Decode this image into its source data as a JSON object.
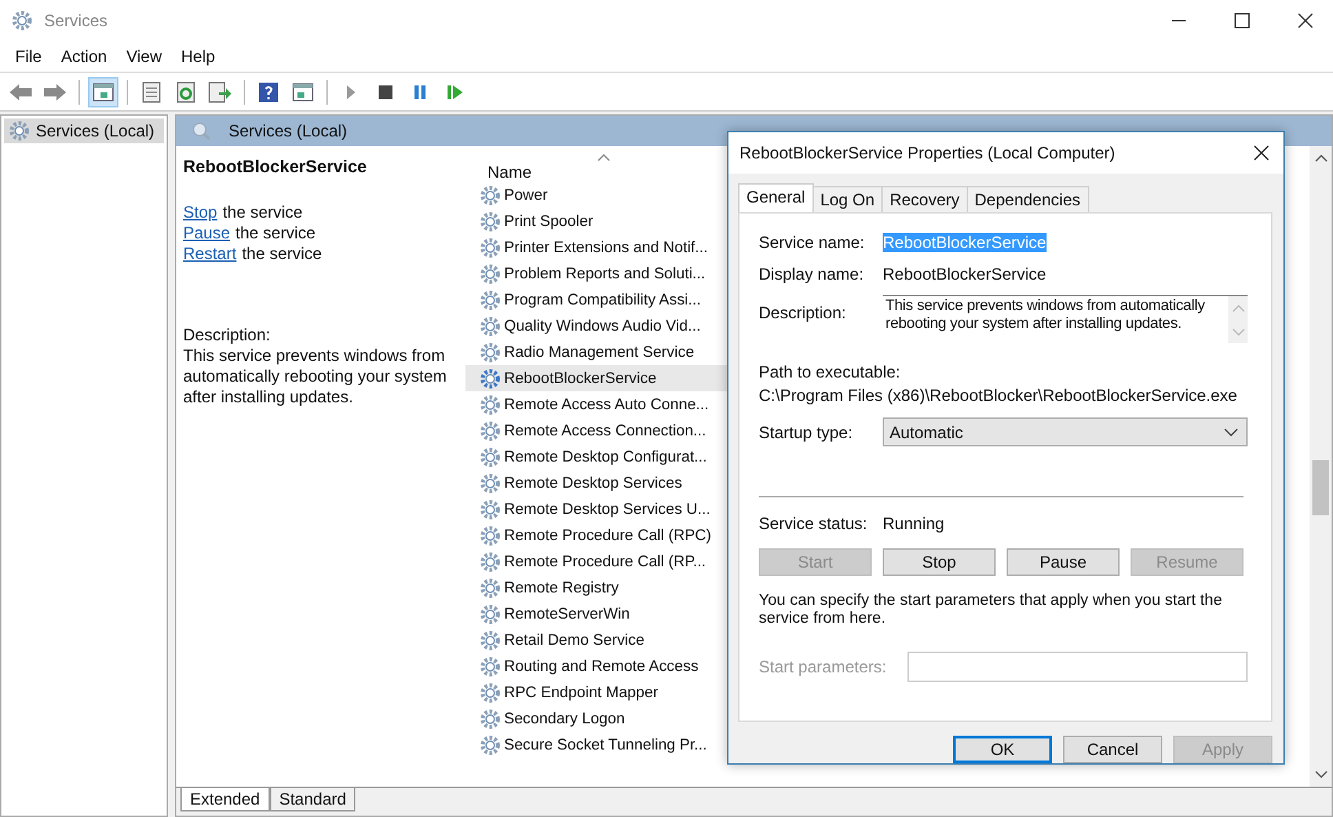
{
  "window": {
    "title": "Services"
  },
  "menu": [
    "File",
    "Action",
    "View",
    "Help"
  ],
  "toolbar": [
    [
      {
        "kind": "back",
        "selected": false
      },
      {
        "kind": "forward",
        "selected": false
      }
    ],
    [
      {
        "kind": "console",
        "selected": true
      }
    ],
    [
      {
        "kind": "properties",
        "selected": false
      },
      {
        "kind": "refresh",
        "selected": false
      },
      {
        "kind": "export",
        "selected": false
      }
    ],
    [
      {
        "kind": "help",
        "selected": false
      },
      {
        "kind": "view",
        "selected": false
      }
    ],
    [
      {
        "kind": "play",
        "selected": false
      },
      {
        "kind": "stop",
        "selected": false
      },
      {
        "kind": "pause",
        "selected": false
      },
      {
        "kind": "resume",
        "selected": false
      }
    ]
  ],
  "tree": {
    "items": [
      {
        "label": "Services (Local)",
        "selected": true
      }
    ]
  },
  "pane": {
    "title": "Services (Local)"
  },
  "details": {
    "service": "RebootBlockerService",
    "actions": [
      {
        "link": "Stop",
        "text": "the service"
      },
      {
        "link": "Pause",
        "text": "the service"
      },
      {
        "link": "Restart",
        "text": "the service"
      }
    ],
    "description_label": "Description:",
    "description": "This service prevents windows from automatically rebooting your system after installing updates."
  },
  "list": {
    "column": "Name",
    "rows": [
      {
        "name": "Power",
        "selected": false
      },
      {
        "name": "Print Spooler",
        "selected": false
      },
      {
        "name": "Printer Extensions and Notif...",
        "selected": false
      },
      {
        "name": "Problem Reports and Soluti...",
        "selected": false
      },
      {
        "name": "Program Compatibility Assi...",
        "selected": false
      },
      {
        "name": "Quality Windows Audio Vid...",
        "selected": false
      },
      {
        "name": "Radio Management Service",
        "selected": false
      },
      {
        "name": "RebootBlockerService",
        "selected": true
      },
      {
        "name": "Remote Access Auto Conne...",
        "selected": false
      },
      {
        "name": "Remote Access Connection...",
        "selected": false
      },
      {
        "name": "Remote Desktop Configurat...",
        "selected": false
      },
      {
        "name": "Remote Desktop Services",
        "selected": false
      },
      {
        "name": "Remote Desktop Services U...",
        "selected": false
      },
      {
        "name": "Remote Procedure Call (RPC)",
        "selected": false
      },
      {
        "name": "Remote Procedure Call (RP...",
        "selected": false
      },
      {
        "name": "Remote Registry",
        "selected": false
      },
      {
        "name": "RemoteServerWin",
        "selected": false
      },
      {
        "name": "Retail Demo Service",
        "selected": false
      },
      {
        "name": "Routing and Remote Access",
        "selected": false
      },
      {
        "name": "RPC Endpoint Mapper",
        "selected": false
      },
      {
        "name": "Secondary Logon",
        "selected": false
      },
      {
        "name": "Secure Socket Tunneling Pr...",
        "selected": false
      }
    ]
  },
  "view_tabs": [
    {
      "label": "Extended",
      "selected": true
    },
    {
      "label": "Standard",
      "selected": false
    }
  ],
  "dialog": {
    "title": "RebootBlockerService Properties (Local Computer)",
    "tabs": [
      {
        "label": "General",
        "selected": true
      },
      {
        "label": "Log On",
        "selected": false
      },
      {
        "label": "Recovery",
        "selected": false
      },
      {
        "label": "Dependencies",
        "selected": false
      }
    ],
    "service_name_label": "Service name:",
    "service_name": "RebootBlockerService",
    "service_name_highlighted": true,
    "display_name_label": "Display name:",
    "display_name": "RebootBlockerService",
    "description_label": "Description:",
    "description": "This service prevents windows from automatically rebooting your system after installing updates.",
    "path_label": "Path to executable:",
    "path": "C:\\Program Files (x86)\\RebootBlocker\\RebootBlockerService.exe",
    "startup_label": "Startup type:",
    "startup_value": "Automatic",
    "status_label": "Service status:",
    "status_value": "Running",
    "control_buttons": [
      {
        "label": "Start",
        "disabled": true
      },
      {
        "label": "Stop",
        "disabled": false
      },
      {
        "label": "Pause",
        "disabled": false
      },
      {
        "label": "Resume",
        "disabled": true
      }
    ],
    "hint": "You can specify the start parameters that apply when you start the service from here.",
    "params_label": "Start parameters:",
    "params_disabled": true,
    "buttons": [
      {
        "label": "OK",
        "disabled": false,
        "default": true
      },
      {
        "label": "Cancel",
        "disabled": false,
        "default": false
      },
      {
        "label": "Apply",
        "disabled": true,
        "default": false
      }
    ]
  }
}
